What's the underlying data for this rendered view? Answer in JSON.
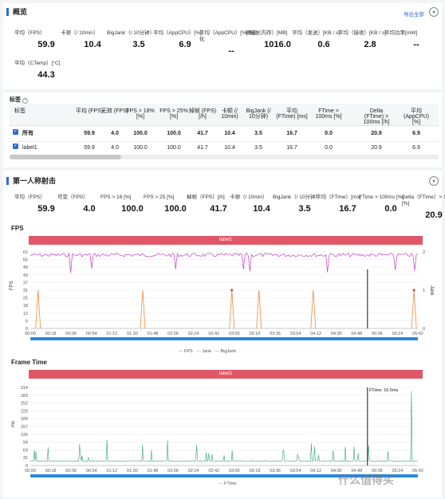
{
  "overview": {
    "title": "概览",
    "export_label": "导出全部",
    "metrics": [
      {
        "label": "平均（FPS）",
        "value": "59.9"
      },
      {
        "label": "卡顿（/ 10min）",
        "value": "10.4"
      },
      {
        "label": "BigJank（/ 10分钟）",
        "value": "3.5"
      },
      {
        "label": "平均（AppCPU）[%]",
        "value": "6.9"
      },
      {
        "label": "平均（AppCPU）[%] 标准化",
        "value": "--"
      },
      {
        "label": "峰值（内存）[MB]",
        "value": "1016.0"
      },
      {
        "label": "平均（发送）[KB / s]",
        "value": "0.6"
      },
      {
        "label": "平均（接收）[KB / s]",
        "value": "2.8"
      },
      {
        "label": "平均功率[mW]",
        "value": "--"
      },
      {
        "label": "平均（CTemp）[°C]",
        "value": "44.3"
      }
    ]
  },
  "labels": {
    "title": "标签",
    "headers": [
      "标签",
      "平均 (FPS)",
      "无效 (FPS)",
      "FPS > 18% [%]",
      "FPS > 25% [%]",
      "掉帧 (FPS) [/h]",
      "卡顿 (/ 10min)",
      "BigJank (/ 10分钟)",
      "平均 (FTime) [ms]",
      "FTime > 100ms [%]",
      "Delta (FTime) > 100ms [/h]",
      "平均 (AppCPU) [%]",
      "Ap"
    ],
    "rows": [
      {
        "name": "所有",
        "values": [
          "59.9",
          "4.0",
          "100.0",
          "100.0",
          "41.7",
          "10.4",
          "3.5",
          "16.7",
          "0.0",
          "20.9",
          "6.9"
        ]
      },
      {
        "name": "label1",
        "values": [
          "59.9",
          "4.0",
          "100.0",
          "100.0",
          "41.7",
          "10.4",
          "3.5",
          "16.7",
          "0.0",
          "20.9",
          "6.9"
        ]
      }
    ]
  },
  "game": {
    "title": "第一人称射击",
    "metrics": [
      {
        "label": "平均（FPS）",
        "value": "59.9"
      },
      {
        "label": "可变（FPS）",
        "value": "4.0"
      },
      {
        "label": "FPS > 18 [%]",
        "value": "100.0"
      },
      {
        "label": "FPS > 25 [%]",
        "value": "100.0"
      },
      {
        "label": "掉帧（FPS）[/h]",
        "value": "41.7"
      },
      {
        "label": "卡顿（/ 10min）",
        "value": "10.4"
      },
      {
        "label": "BigJank（/ 10分钟）",
        "value": "3.5"
      },
      {
        "label": "平均（FTime）[ms]",
        "value": "16.7"
      },
      {
        "label": "FTime > 100ms [%]",
        "value": "0.0"
      },
      {
        "label": "Delta（FTime）> 100ms [%]",
        "value": "20.9"
      }
    ]
  },
  "fps_chart": {
    "title": "FPS",
    "banner": "label1",
    "ylabel_left": "FPS",
    "ylabel_right": "Jank",
    "yticks_left": [
      "61",
      "55",
      "49",
      "43",
      "37",
      "31",
      "25",
      "18",
      "12",
      "6",
      "0"
    ],
    "yticks_right": [
      "2",
      "1",
      "0"
    ],
    "xticks": [
      "00:00",
      "00:18",
      "00:36",
      "00:54",
      "01:12",
      "01:30",
      "01:48",
      "02:06",
      "02:24",
      "02:42",
      "03:00",
      "03:18",
      "03:36",
      "03:54",
      "04:12",
      "04:30",
      "04:48",
      "05:06",
      "05:24",
      "05:42"
    ],
    "legend": [
      "FPS",
      "Jank",
      "BigJank"
    ]
  },
  "ftime_chart": {
    "title": "Frame Time",
    "banner": "label1",
    "ylabel": "ms",
    "tooltip": "FTime: 16.5ms",
    "yticks": [
      "314",
      "283",
      "252",
      "220",
      "189",
      "157",
      "126",
      "94",
      "63",
      "31",
      "0"
    ],
    "xticks": [
      "00:00",
      "00:18",
      "00:36",
      "00:54",
      "01:12",
      "01:30",
      "01:48",
      "02:06",
      "02:24",
      "02:42",
      "03:00",
      "03:18",
      "03:36",
      "03:54",
      "04:12",
      "04:30",
      "04:48",
      "05:06",
      "05:24",
      "05:42"
    ],
    "legend": [
      "FTime"
    ]
  },
  "watermark": "什么值得买",
  "colors": {
    "accent": "#2f6bd8",
    "banner": "#e05767",
    "fps": "#c13fc1",
    "jank": "#f08a3c",
    "ftime": "#3aa57b"
  }
}
